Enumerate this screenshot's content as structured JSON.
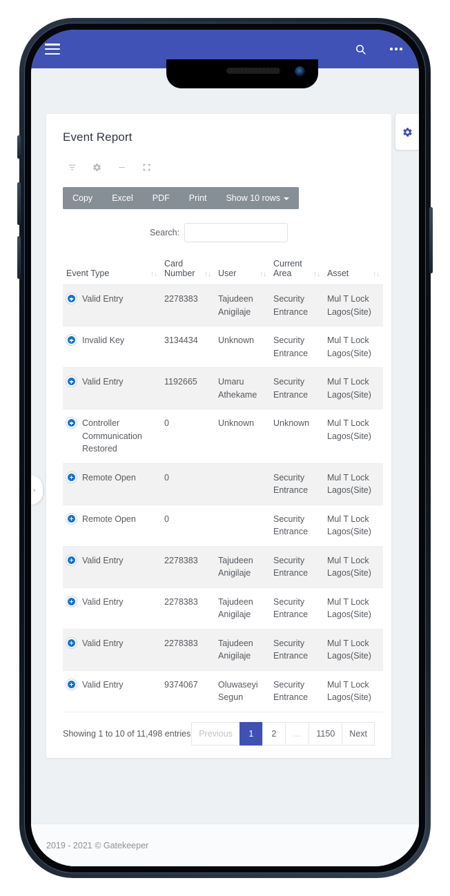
{
  "app_bar": {
    "menu_icon": "hamburger-icon",
    "search_icon": "search-icon",
    "overflow_icon": "overflow-menu-icon",
    "background_color": "#4052b5"
  },
  "side_tabs": {
    "settings_icon": "gear-icon",
    "drawer_chevron": "›"
  },
  "card": {
    "title": "Event Report",
    "widget_tools": [
      {
        "name": "filter-icon"
      },
      {
        "name": "gear-icon"
      },
      {
        "name": "collapse-icon"
      },
      {
        "name": "expand-icon"
      }
    ],
    "export_buttons": [
      {
        "label": "Copy",
        "name": "copy-button"
      },
      {
        "label": "Excel",
        "name": "excel-button"
      },
      {
        "label": "PDF",
        "name": "pdf-button"
      },
      {
        "label": "Print",
        "name": "print-button"
      },
      {
        "label": "Show 10 rows",
        "name": "rows-per-page-dropdown"
      }
    ],
    "search": {
      "label": "Search:",
      "value": "",
      "placeholder": ""
    }
  },
  "table": {
    "columns": [
      {
        "label": "Event Type",
        "sort": "↑↓"
      },
      {
        "label": "Card Number",
        "sort": "↑↓"
      },
      {
        "label": "User",
        "sort": "↑↓"
      },
      {
        "label": "Current Area",
        "sort": "↑↓"
      },
      {
        "label": "Asset",
        "sort": "↑↓"
      }
    ],
    "rows": [
      {
        "event_type": "Valid Entry",
        "card_number": "2278383",
        "user": "Tajudeen Anigilaje",
        "current_area": "Security Entrance",
        "asset": "Mul T Lock Lagos(Site)"
      },
      {
        "event_type": "Invalid Key",
        "card_number": "3134434",
        "user": "Unknown",
        "current_area": "Security Entrance",
        "asset": "Mul T Lock Lagos(Site)"
      },
      {
        "event_type": "Valid Entry",
        "card_number": "1192665",
        "user": "Umaru Athekame",
        "current_area": "Security Entrance",
        "asset": "Mul T Lock Lagos(Site)"
      },
      {
        "event_type": "Controller Communication Restored",
        "card_number": "0",
        "user": "Unknown",
        "current_area": "Unknown",
        "asset": "Mul T Lock Lagos(Site)"
      },
      {
        "event_type": "Remote Open",
        "card_number": "0",
        "user": "",
        "current_area": "Security Entrance",
        "asset": "Mul T Lock Lagos(Site)"
      },
      {
        "event_type": "Remote Open",
        "card_number": "0",
        "user": "",
        "current_area": "Security Entrance",
        "asset": "Mul T Lock Lagos(Site)"
      },
      {
        "event_type": "Valid Entry",
        "card_number": "2278383",
        "user": "Tajudeen Anigilaje",
        "current_area": "Security Entrance",
        "asset": "Mul T Lock Lagos(Site)"
      },
      {
        "event_type": "Valid Entry",
        "card_number": "2278383",
        "user": "Tajudeen Anigilaje",
        "current_area": "Security Entrance",
        "asset": "Mul T Lock Lagos(Site)"
      },
      {
        "event_type": "Valid Entry",
        "card_number": "2278383",
        "user": "Tajudeen Anigilaje",
        "current_area": "Security Entrance",
        "asset": "Mul T Lock Lagos(Site)"
      },
      {
        "event_type": "Valid Entry",
        "card_number": "9374067",
        "user": "Oluwaseyi Segun",
        "current_area": "Security Entrance",
        "asset": "Mul T Lock Lagos(Site)"
      }
    ]
  },
  "footer_controls": {
    "entries_info": "Showing 1 to 10 of 11,498 entries",
    "pagination": [
      {
        "label": "Previous",
        "state": "disabled",
        "name": "pagination-previous"
      },
      {
        "label": "1",
        "state": "active",
        "name": "pagination-page-1"
      },
      {
        "label": "2",
        "state": "normal",
        "name": "pagination-page-2"
      },
      {
        "label": "…",
        "state": "ellipsis",
        "name": "pagination-ellipsis"
      },
      {
        "label": "1150",
        "state": "normal",
        "name": "pagination-page-1150"
      },
      {
        "label": "Next",
        "state": "normal",
        "name": "pagination-next"
      }
    ]
  },
  "page_footer": {
    "text": "2019 - 2021 © Gatekeeper"
  }
}
